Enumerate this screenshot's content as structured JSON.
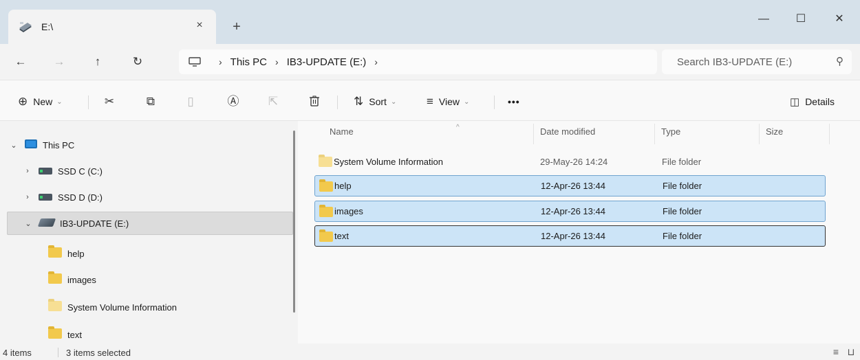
{
  "window": {
    "tab_title": "E:\\",
    "tab_close": "×",
    "new_tab": "+",
    "minimize": "—",
    "maximize": "☐",
    "close": "✕"
  },
  "nav": {
    "back": "←",
    "forward": "→",
    "up": "↑",
    "refresh": "↻"
  },
  "address": {
    "crumbs": [
      "This PC",
      "IB3-UPDATE (E:)"
    ],
    "separator": "›"
  },
  "search": {
    "placeholder": "Search IB3-UPDATE (E:)",
    "icon": "⚲"
  },
  "toolbar": {
    "new_label": "New",
    "new_icon": "⊕",
    "sort_label": "Sort",
    "sort_icon": "⇅",
    "view_label": "View",
    "view_icon": "≡",
    "more_label": "•••",
    "details_label": "Details",
    "details_icon": "◫",
    "caret": "⌄",
    "cut_icon": "✂",
    "copy_icon": "⧉",
    "paste_icon": "▯",
    "rename_icon": "Ⓐ",
    "share_icon": "⇱",
    "delete_icon": "🗑"
  },
  "navpane": {
    "expand_open": "⌄",
    "expand_closed": "›",
    "items": [
      {
        "label": "This PC",
        "icon": "monitor-icon"
      },
      {
        "label": "SSD C (C:)",
        "icon": "drive-icon"
      },
      {
        "label": "SSD D (D:)",
        "icon": "drive-icon"
      },
      {
        "label": "IB3-UPDATE (E:)",
        "icon": "usb-drive-icon"
      },
      {
        "label": "help",
        "icon": "folder-icon"
      },
      {
        "label": "images",
        "icon": "folder-icon"
      },
      {
        "label": "System Volume Information",
        "icon": "folder-icon"
      },
      {
        "label": "text",
        "icon": "folder-icon"
      }
    ]
  },
  "files": {
    "columns": [
      "Name",
      "Date modified",
      "Type",
      "Size"
    ],
    "sort_indicator": "^",
    "rows": [
      {
        "name": "System Volume Information",
        "date": "29-May-26 14:24",
        "type": "File folder",
        "selected": false
      },
      {
        "name": "help",
        "date": "12-Apr-26 13:44",
        "type": "File folder",
        "selected": true
      },
      {
        "name": "images",
        "date": "12-Apr-26 13:44",
        "type": "File folder",
        "selected": true
      },
      {
        "name": "text",
        "date": "12-Apr-26 13:44",
        "type": "File folder",
        "selected": true
      }
    ]
  },
  "status": {
    "item_count": "4 items",
    "selection": "3 items selected",
    "details_view_icon": "≡",
    "tiles_view_icon": "⊔"
  },
  "colors": {
    "selection_bg": "#cce4f7",
    "selection_border": "#6fa3cf",
    "folder": "#f2c94c",
    "titlebar": "#d6e1ea"
  }
}
